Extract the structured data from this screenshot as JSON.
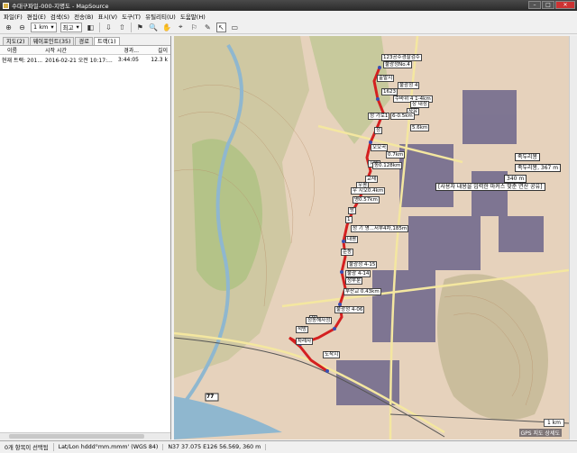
{
  "window": {
    "title": "수대구파일-000-지명도 - MapSource"
  },
  "menu": [
    "파일(F)",
    "편집(E)",
    "검색(S)",
    "전송(B)",
    "표시(V)",
    "도구(T)",
    "유틸리티(U)",
    "도움말(H)"
  ],
  "toolbar": {
    "scale": "1 km",
    "detail": "최고"
  },
  "tabs": [
    "지도(2)",
    "웨이포인트(35)",
    "경로",
    "트랙(1)"
  ],
  "columns": [
    "이름",
    "시작 시간",
    "경과...",
    "길이"
  ],
  "rows": [
    {
      "name": "현재 트랙: 201...",
      "start": "2016-02-21 오전 10:17:...",
      "elapsed": "3:44:05",
      "length": "12.3 k"
    }
  ],
  "status": {
    "selected": "0개 항목이 선택됨",
    "format": "Lat/Lon hddd°mm.mmm' (WGS 84)",
    "coords": "N37 37.075 E126 56.569, 360 m"
  },
  "map": {
    "labels": [
      "123공수경찰검수",
      "불광정No.4",
      "출발지",
      "불광정 4",
      "수바위 4 1-4km",
      "1623",
      "상 내성",
      "사유",
      "정 가로1",
      "6-0.5km",
      "정",
      "5.6km",
      "오오곡",
      "0.7km",
      "시반",
      "동0.128km",
      "교재",
      "우평",
      "우 시오0.4km",
      "명0.57km",
      "방",
      "1",
      "성 기 영...서부4차,185m",
      "대평",
      "순동",
      "불광정 4-15",
      "불광 4-14",
      "성부분",
      "부산교 0.43km",
      "불광정 4-06",
      "삼",
      "정동해자정",
      "석방",
      "차례자",
      "도착지"
    ],
    "poi": [
      "족두리봉",
      "족두리봉, 367 m",
      "340 m",
      "[사용자 내용을 입력한 마커스 맞춘 연산 공유]"
    ],
    "road_badge": "77",
    "scale": "1 km",
    "gps_note": "GPS 지도 상세도"
  },
  "colors": {
    "route": "#d42020",
    "water": "#8fb7cf",
    "urban": "#23236b",
    "forest": "#a5c67a"
  }
}
